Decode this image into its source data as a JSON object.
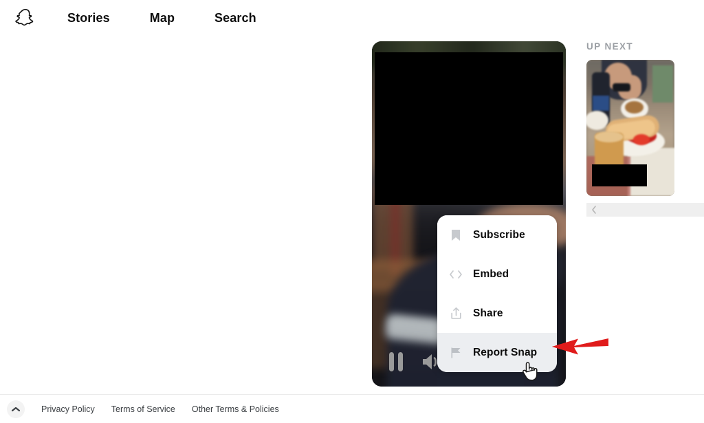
{
  "header": {
    "logo": "snapchat-ghost-logo",
    "nav": [
      {
        "label": "Stories"
      },
      {
        "label": "Map"
      },
      {
        "label": "Search"
      }
    ]
  },
  "player": {
    "state": "playing",
    "pause_icon": "pause-icon",
    "volume_icon": "volume-on-icon",
    "redacted": true
  },
  "context_menu": {
    "items": [
      {
        "label": "Subscribe",
        "icon": "bookmark-icon",
        "active": false
      },
      {
        "label": "Embed",
        "icon": "code-icon",
        "active": false
      },
      {
        "label": "Share",
        "icon": "share-icon",
        "active": false
      },
      {
        "label": "Report Snap",
        "icon": "flag-icon",
        "active": true
      }
    ]
  },
  "annotation": {
    "arrow": "red-arrow-pointing-left",
    "target": "Report Snap",
    "cursor": "pointer-hand-cursor"
  },
  "up_next": {
    "title": "UP NEXT",
    "thumbnail_alt": "food-snap-thumbnail",
    "prev_icon": "chevron-left-icon"
  },
  "footer": {
    "collapse_icon": "chevron-up-icon",
    "links": [
      {
        "label": "Privacy Policy"
      },
      {
        "label": "Terms of Service"
      },
      {
        "label": "Other Terms & Policies"
      }
    ]
  },
  "colors": {
    "accent_red": "#e01b1b",
    "menu_bg": "#ffffff",
    "menu_active_bg": "#eceef1",
    "icon_gray": "#c7cace",
    "text_dark": "#0b0b0b",
    "up_next_gray": "#9b9fa4",
    "page_bg": "#ffffff"
  }
}
